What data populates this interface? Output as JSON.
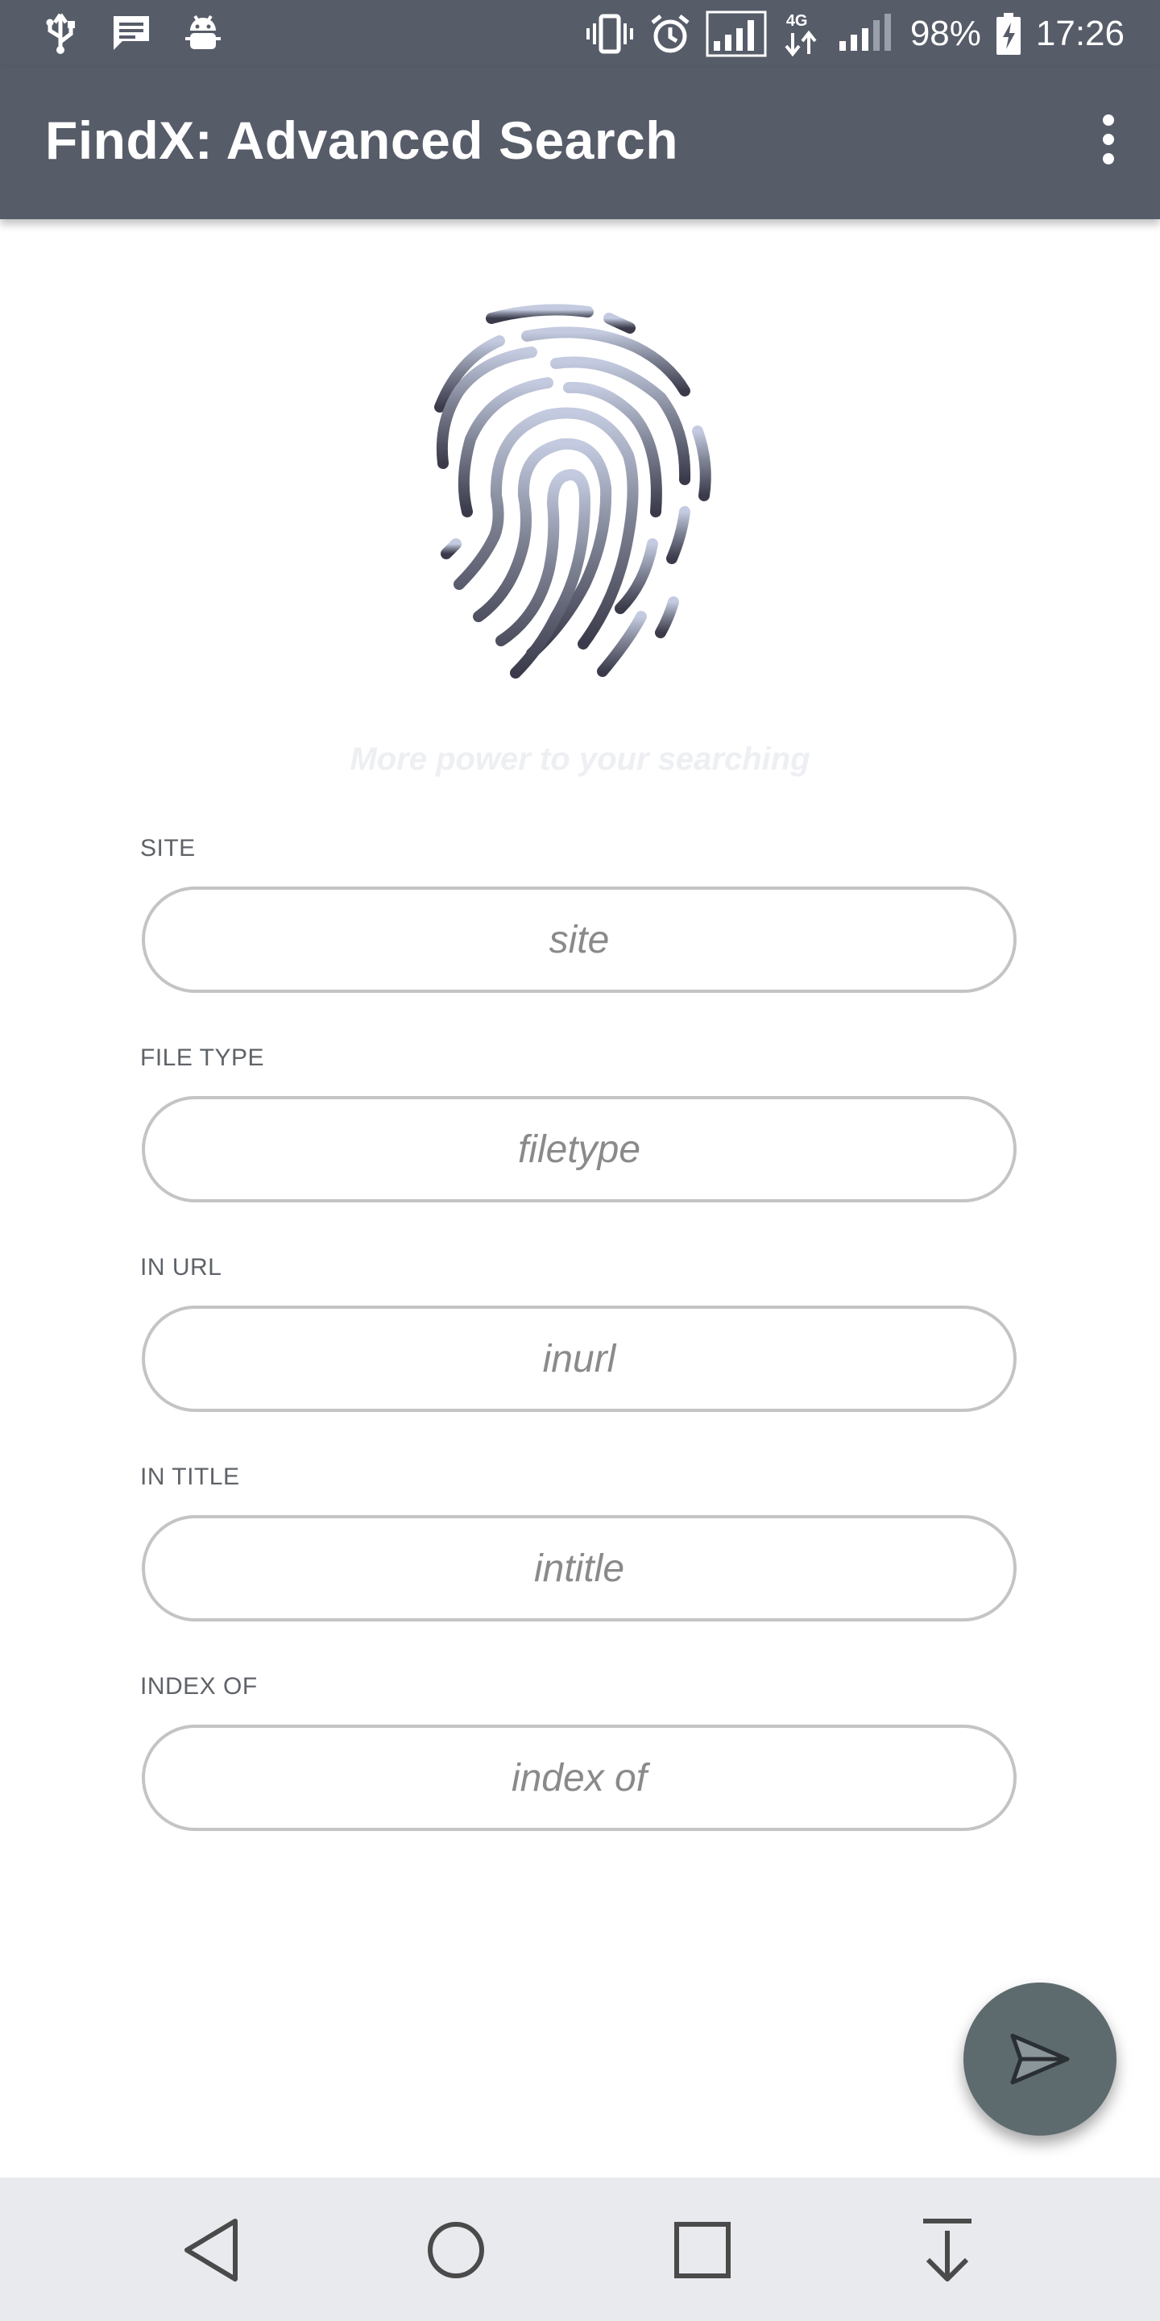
{
  "status_bar": {
    "battery": "98%",
    "time": "17:26",
    "network": "4G",
    "icons": [
      "usb-icon",
      "message-icon",
      "android-debug-icon",
      "vibrate-icon",
      "alarm-icon",
      "signal-icon",
      "battery-icon"
    ]
  },
  "app_bar": {
    "title": "FindX: Advanced Search",
    "menu_icon": "more-vert-icon"
  },
  "hero": {
    "logo_icon": "fingerprint-icon",
    "tagline": "More power to your searching"
  },
  "fields": [
    {
      "label": "SITE",
      "placeholder": "site"
    },
    {
      "label": "FILE TYPE",
      "placeholder": "filetype"
    },
    {
      "label": "IN URL",
      "placeholder": "inurl"
    },
    {
      "label": "IN TITLE",
      "placeholder": "intitle"
    },
    {
      "label": "INDEX OF",
      "placeholder": "index of"
    }
  ],
  "fab": {
    "icon": "send-icon"
  },
  "nav_bar": {
    "icons": [
      "back-icon",
      "home-icon",
      "recents-icon",
      "notification-pull-icon"
    ]
  },
  "colors": {
    "app_bar": "#575c69",
    "fab": "#5d6b6f",
    "nav_bar": "#e9eaee",
    "input_border": "#c4c4c4"
  }
}
